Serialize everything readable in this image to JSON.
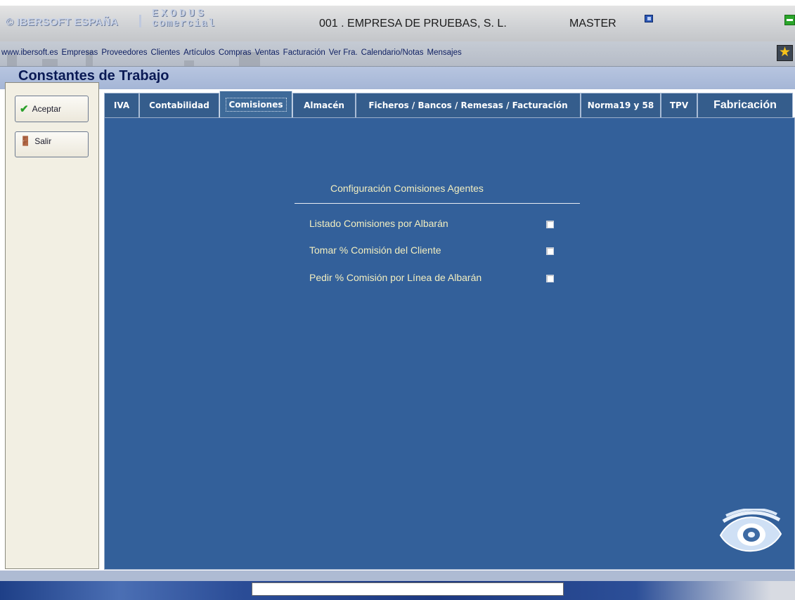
{
  "header": {
    "brand": "© IBERSOFT ESPAÑA",
    "product_top": "EXODUS",
    "product_bottom": "comercial",
    "company": "001 . EMPRESA DE PRUEBAS, S. L.",
    "user": "MASTER"
  },
  "menu": {
    "items": [
      "www.ibersoft.es",
      "Empresas",
      "Proveedores",
      "Clientes",
      "Artículos",
      "Compras",
      "Ventas",
      "Facturación",
      "Ver Fra.",
      "Calendario/Notas",
      "Mensajes"
    ]
  },
  "page": {
    "title": "Constantes de Trabajo"
  },
  "sidebar": {
    "accept_label": "Aceptar",
    "exit_label": "Salir"
  },
  "tabs": [
    "IVA",
    "Contabilidad",
    "Comisiones",
    "Almacén",
    "Ficheros / Bancos / Remesas / Facturación",
    "Norma19 y 58",
    "TPV",
    "Fabricación"
  ],
  "active_tab": "Comisiones",
  "panel": {
    "section_title": "Configuración Comisiones Agentes",
    "options": [
      {
        "label": "Listado Comisiones por Albarán",
        "checked": false
      },
      {
        "label": "Tomar % Comisión del Cliente",
        "checked": false
      },
      {
        "label": "Pedir % Comisión por Línea de Albarán",
        "checked": false
      }
    ]
  },
  "colors": {
    "panel_bg": "#33609a",
    "label_text": "#f2eec0",
    "title_text": "#0a1a55"
  }
}
